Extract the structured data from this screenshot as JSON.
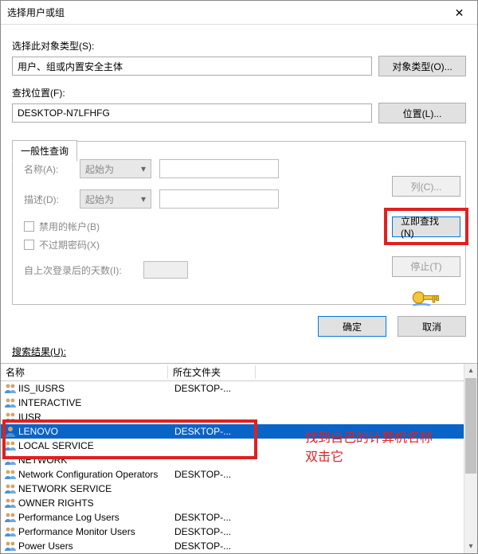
{
  "dialog": {
    "title": "选择用户或组"
  },
  "object_type": {
    "label": "选择此对象类型(S):",
    "value": "用户、组或内置安全主体",
    "button": "对象类型(O)..."
  },
  "location": {
    "label": "查找位置(F):",
    "value": "DESKTOP-N7LFHFG",
    "button": "位置(L)..."
  },
  "tab": {
    "label": "一般性查询"
  },
  "query": {
    "name_label": "名称(A):",
    "desc_label": "描述(D):",
    "combo_text": "起始为",
    "chk_disabled": "禁用的帐户(B)",
    "chk_nonexpire": "不过期密码(X)",
    "days_label": "自上次登录后的天数(I):"
  },
  "buttons": {
    "columns": "列(C)...",
    "find_now": "立即查找(N)",
    "stop": "停止(T)",
    "ok": "确定",
    "cancel": "取消"
  },
  "results_label": "搜索结果(U):",
  "columns": {
    "name": "名称",
    "folder": "所在文件夹"
  },
  "results": [
    {
      "name": "IIS_IUSRS",
      "folder": "DESKTOP-...",
      "type": "group",
      "selected": false
    },
    {
      "name": "INTERACTIVE",
      "folder": "",
      "type": "group",
      "selected": false
    },
    {
      "name": "IUSR",
      "folder": "",
      "type": "group",
      "selected": false
    },
    {
      "name": "LENOVO",
      "folder": "DESKTOP-...",
      "type": "user",
      "selected": true
    },
    {
      "name": "LOCAL SERVICE",
      "folder": "",
      "type": "group",
      "selected": false
    },
    {
      "name": "NETWORK",
      "folder": "",
      "type": "group",
      "selected": false
    },
    {
      "name": "Network Configuration Operators",
      "folder": "DESKTOP-...",
      "type": "group",
      "selected": false
    },
    {
      "name": "NETWORK SERVICE",
      "folder": "",
      "type": "group",
      "selected": false
    },
    {
      "name": "OWNER RIGHTS",
      "folder": "",
      "type": "group",
      "selected": false
    },
    {
      "name": "Performance Log Users",
      "folder": "DESKTOP-...",
      "type": "group",
      "selected": false
    },
    {
      "name": "Performance Monitor Users",
      "folder": "DESKTOP-...",
      "type": "group",
      "selected": false
    },
    {
      "name": "Power Users",
      "folder": "DESKTOP-...",
      "type": "group",
      "selected": false
    }
  ],
  "annotation": {
    "line1": "找到自己的计算机名称",
    "line2": "双击它"
  }
}
